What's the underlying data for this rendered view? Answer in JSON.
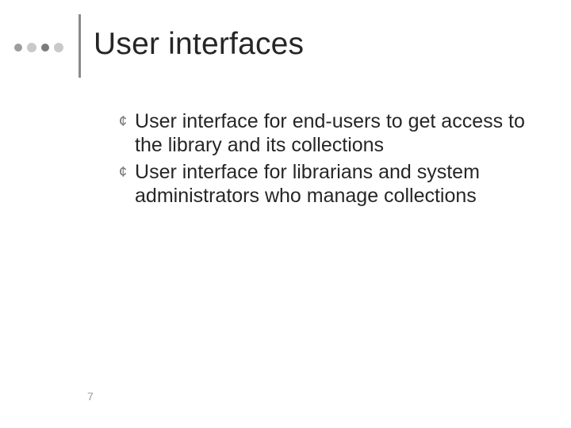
{
  "slide": {
    "title": "User interfaces",
    "bullets": [
      "User interface for end-users to get access to the library and its collections",
      "User interface for librarians and system administrators who manage collections"
    ],
    "page_number": "7"
  }
}
